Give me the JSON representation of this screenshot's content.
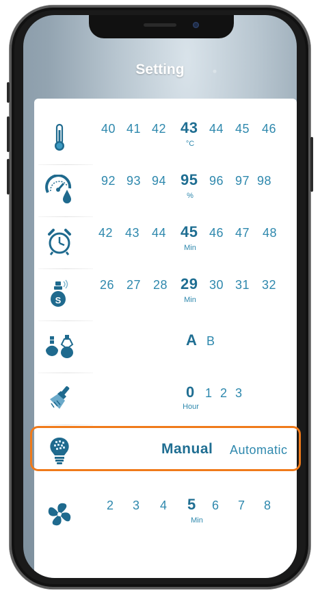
{
  "screen": {
    "title": "Setting"
  },
  "colors": {
    "accent": "#2e88ad",
    "selected": "#1f6e92",
    "highlight": "#f07a1a"
  },
  "rows": [
    {
      "icon": "thermometer-icon",
      "values": [
        "40",
        "41",
        "42",
        "43",
        "44",
        "45",
        "46"
      ],
      "selected": "43",
      "unit": "°C"
    },
    {
      "icon": "humidity-gauge-icon",
      "values": [
        "92",
        "93",
        "94",
        "95",
        "96",
        "97",
        "98"
      ],
      "selected": "95",
      "unit": "%"
    },
    {
      "icon": "alarm-clock-icon",
      "values": [
        "42",
        "43",
        "44",
        "45",
        "46",
        "47",
        "48"
      ],
      "selected": "45",
      "unit": "Min"
    },
    {
      "icon": "scent-dispenser-icon",
      "values": [
        "26",
        "27",
        "28",
        "29",
        "30",
        "31",
        "32"
      ],
      "selected": "29",
      "unit": "Min"
    },
    {
      "icon": "scent-bottles-icon",
      "values": [
        "A",
        "B"
      ],
      "selected": "A",
      "unit": ""
    },
    {
      "icon": "cleaning-brush-icon",
      "values": [
        "0",
        "1",
        "2",
        "3"
      ],
      "selected": "0",
      "unit": "Hour"
    },
    {
      "icon": "light-bulb-icon",
      "values": [
        "Manual",
        "Automatic"
      ],
      "selected": "Manual",
      "unit": ""
    },
    {
      "icon": "fan-icon",
      "values": [
        "2",
        "3",
        "4",
        "5",
        "6",
        "7",
        "8"
      ],
      "selected": "5",
      "unit": "Min"
    }
  ]
}
